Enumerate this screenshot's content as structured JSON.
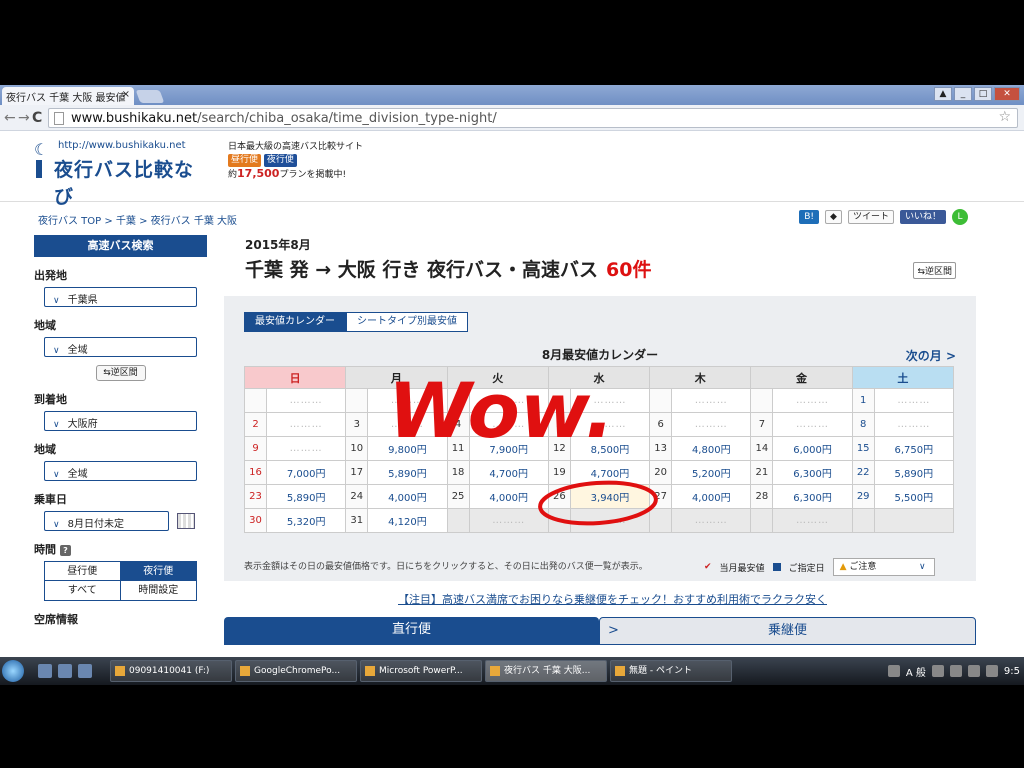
{
  "browser": {
    "tab_title": "夜行バス 千葉 大阪 最安値",
    "tab_close": "×",
    "url_host": "www.bushikaku.net",
    "url_path": "/search/chiba_osaka/time_division_type-night/",
    "back_icon": "←",
    "forward_icon": "→",
    "reload_icon": "C",
    "star_icon": "☆"
  },
  "header": {
    "logo_url": "http://www.bushikaku.net",
    "logo_name": "夜行バス比較なび",
    "tagline": "日本最大級の高速バス比較サイト",
    "badge_day": "昼行便",
    "badge_night": "夜行便",
    "plan_count_prefix": "約",
    "plan_count": "17,500",
    "plan_count_suffix": "プランを掲載中!"
  },
  "breadcrumb": "夜行バス TOP > 千葉 > 夜行バス 千葉 大阪",
  "social": {
    "hatena": "B!",
    "tweet": "ツイート",
    "like": "いいね！",
    "line": "L"
  },
  "sidebar": {
    "title": "高速バス検索",
    "departure_label": "出発地",
    "departure_value": "千葉県",
    "departure_area_label": "地域",
    "departure_area_value": "全域",
    "reverse_button": "⇆逆区間",
    "arrival_label": "到着地",
    "arrival_value": "大阪府",
    "arrival_area_label": "地域",
    "arrival_area_value": "全域",
    "date_label": "乗車日",
    "date_value": "8月日付未定",
    "time_label": "時間",
    "time_options": [
      "昼行便",
      "夜行便",
      "すべて",
      "時間設定"
    ],
    "time_active": "夜行便",
    "vacancy_label": "空席情報"
  },
  "main": {
    "month": "2015年8月",
    "route": "千葉 発 → 大阪 行き 夜行バス・高速バス",
    "count": "60件",
    "reverse_link": "⇆逆区間",
    "calendar_tabs": [
      "最安値カレンダー",
      "シートタイプ別最安値"
    ],
    "calendar_heading": "8月最安値カレンダー",
    "next_month": "次の月 >",
    "weekdays": [
      "日",
      "月",
      "火",
      "水",
      "木",
      "金",
      "土"
    ],
    "weeks": [
      [
        {
          "d": "",
          "f": "………"
        },
        {
          "d": "",
          "f": "………"
        },
        {
          "d": "",
          "f": "………"
        },
        {
          "d": "",
          "f": "………"
        },
        {
          "d": "",
          "f": "………"
        },
        {
          "d": "",
          "f": "………"
        },
        {
          "d": "1",
          "f": "………"
        }
      ],
      [
        {
          "d": "2",
          "f": "………"
        },
        {
          "d": "3",
          "f": "………"
        },
        {
          "d": "4",
          "f": "………"
        },
        {
          "d": "5",
          "f": "………"
        },
        {
          "d": "6",
          "f": "………"
        },
        {
          "d": "7",
          "f": "………"
        },
        {
          "d": "8",
          "f": "………"
        }
      ],
      [
        {
          "d": "9",
          "f": "………"
        },
        {
          "d": "10",
          "f": "9,800円"
        },
        {
          "d": "11",
          "f": "7,900円"
        },
        {
          "d": "12",
          "f": "8,500円"
        },
        {
          "d": "13",
          "f": "4,800円"
        },
        {
          "d": "14",
          "f": "6,000円"
        },
        {
          "d": "15",
          "f": "6,750円"
        }
      ],
      [
        {
          "d": "16",
          "f": "7,000円"
        },
        {
          "d": "17",
          "f": "5,890円"
        },
        {
          "d": "18",
          "f": "4,700円"
        },
        {
          "d": "19",
          "f": "4,700円"
        },
        {
          "d": "20",
          "f": "5,200円"
        },
        {
          "d": "21",
          "f": "6,300円"
        },
        {
          "d": "22",
          "f": "5,890円"
        }
      ],
      [
        {
          "d": "23",
          "f": "5,890円"
        },
        {
          "d": "24",
          "f": "4,000円"
        },
        {
          "d": "25",
          "f": "4,000円"
        },
        {
          "d": "26",
          "f": "3,940円",
          "cheapest": true
        },
        {
          "d": "27",
          "f": "4,000円"
        },
        {
          "d": "28",
          "f": "6,300円"
        },
        {
          "d": "29",
          "f": "5,500円"
        }
      ],
      [
        {
          "d": "30",
          "f": "5,320円"
        },
        {
          "d": "31",
          "f": "4,120円"
        },
        {
          "d": "",
          "f": "………",
          "blank": true
        },
        {
          "d": "",
          "f": "………",
          "blank": true
        },
        {
          "d": "",
          "f": "………",
          "blank": true
        },
        {
          "d": "",
          "f": "………",
          "blank": true
        },
        {
          "d": "",
          "f": "",
          "blank": true
        }
      ]
    ],
    "calendar_note": "表示金額はその日の最安値価格です。日にちをクリックすると、その日に出発のバス便一覧が表示。",
    "legend_cheapest": "当月最安値",
    "legend_selected": "ご指定日",
    "caution": "ご注意",
    "notice": "【注目】高速バス満席でお困りなら乗継便をチェック！おすすめ利用術でラクラク安く",
    "result_tab_direct": "直行便",
    "result_tab_transfer": "乗継便"
  },
  "annotation": {
    "text": "Wow."
  },
  "taskbar": {
    "tasks": [
      "09091410041 (F:)",
      "GoogleChromePo...",
      "Microsoft PowerP...",
      "夜行バス 千葉 大阪...",
      "無題 - ペイント"
    ],
    "active_task": "夜行バス 千葉 大阪...",
    "ime": "A 般",
    "clock": "9:5"
  },
  "colors": {
    "brand_blue": "#1a4d8f",
    "price_red": "#d11",
    "annotation_red": "#e01010"
  }
}
